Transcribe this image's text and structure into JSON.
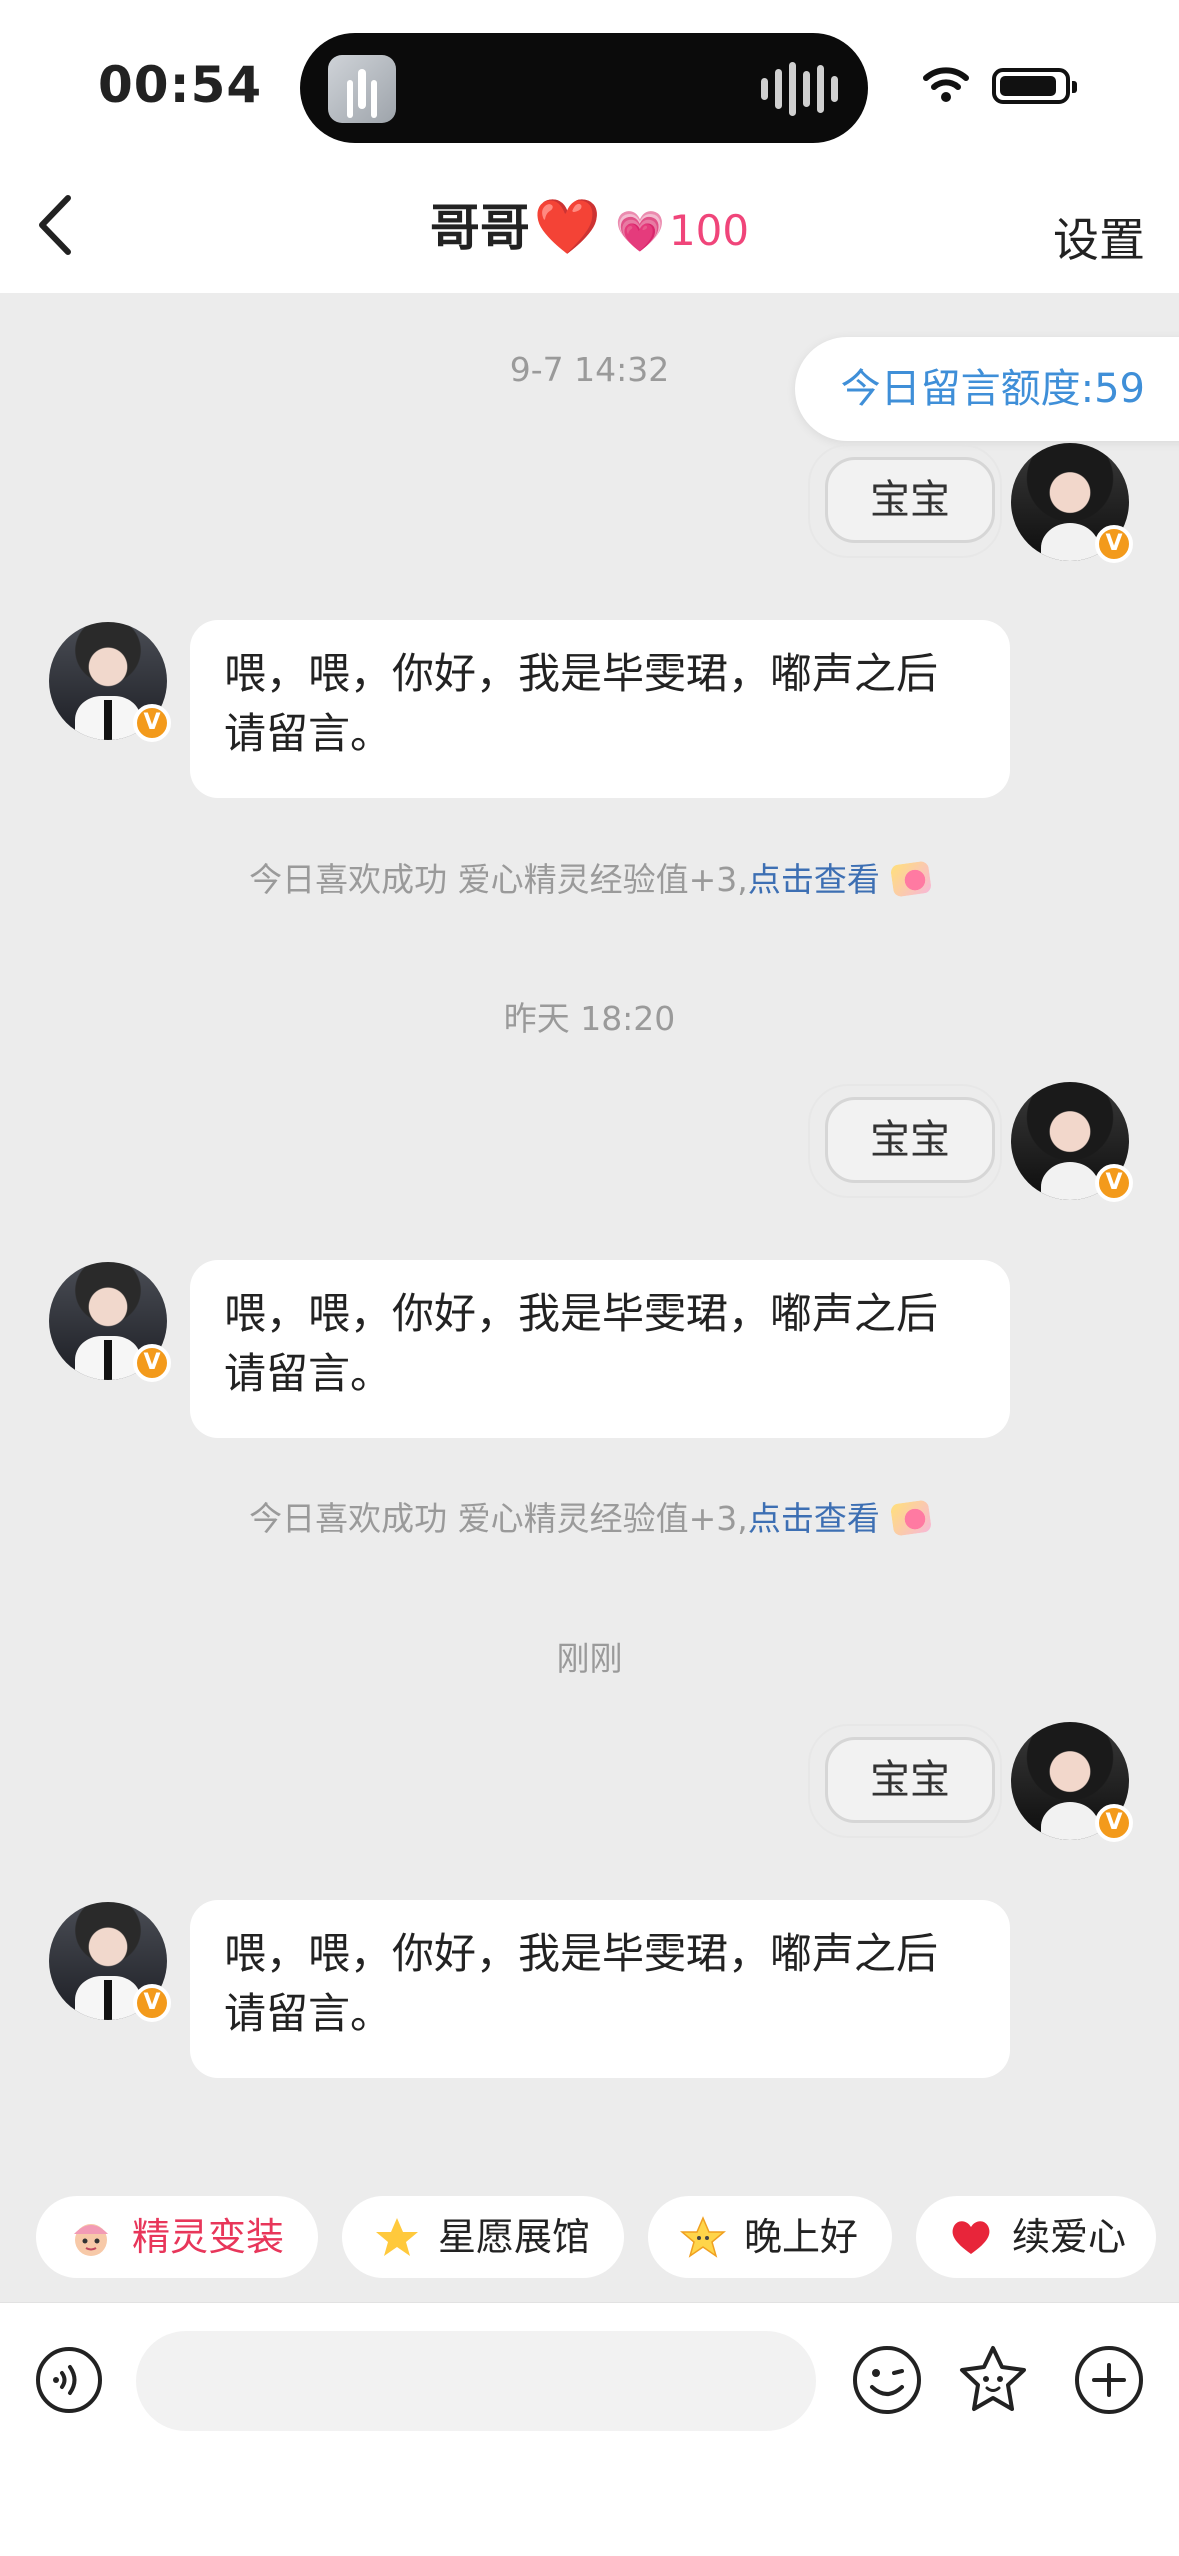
{
  "status_bar": {
    "time": "00:54"
  },
  "header": {
    "title": "哥哥",
    "heart_emoji": "❤️",
    "intimacy_icon": "💗",
    "intimacy_value": "100",
    "settings_label": "设置"
  },
  "quota": {
    "text": "今日留言额度:59"
  },
  "messages": [
    {
      "timestamp": "9-7 14:32",
      "sent_text": "宝宝",
      "received_text": "喂，喂，你好，我是毕雯珺，嘟声之后请留言。",
      "system_text": "今日喜欢成功 爱心精灵经验值+3,",
      "system_link": "点击查看"
    },
    {
      "timestamp": "昨天 18:20",
      "sent_text": "宝宝",
      "received_text": "喂，喂，你好，我是毕雯珺，嘟声之后请留言。",
      "system_text": "今日喜欢成功 爱心精灵经验值+3,",
      "system_link": "点击查看"
    },
    {
      "timestamp": "刚刚",
      "sent_text": "宝宝",
      "received_text": "喂，喂，你好，我是毕雯珺，嘟声之后请留言。"
    }
  ],
  "quick_replies": [
    {
      "label": "精灵变装",
      "icon": "elf-icon"
    },
    {
      "label": "星愿展馆",
      "icon": "star-icon"
    },
    {
      "label": "晚上好",
      "icon": "sparkle-star-icon"
    },
    {
      "label": "续爱心",
      "icon": "heart-icon"
    }
  ],
  "input": {
    "placeholder": ""
  },
  "colors": {
    "accent_pink": "#f0457a",
    "link_blue": "#3d6fb3",
    "quota_blue": "#3f8fd8",
    "background": "#ececec"
  }
}
